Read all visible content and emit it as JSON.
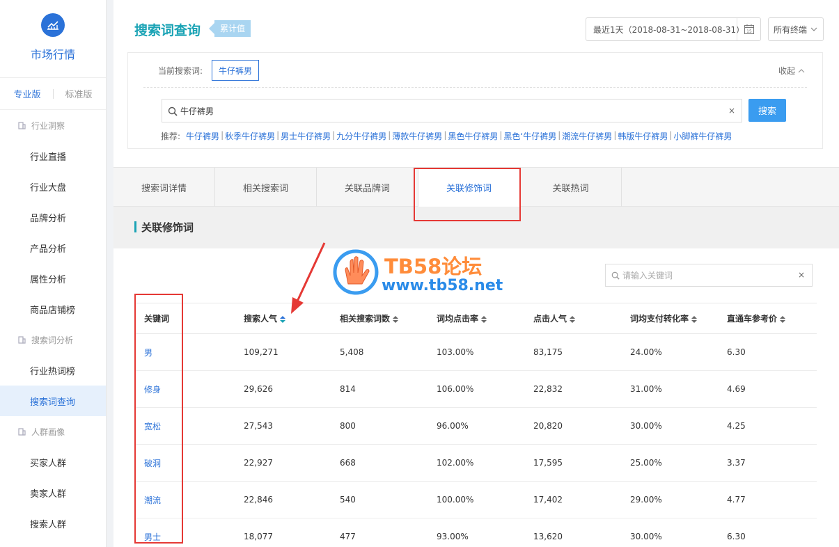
{
  "sidebar": {
    "title": "市场行情",
    "versions": [
      "专业版",
      "标准版"
    ],
    "groups": [
      {
        "label": "行业洞察",
        "items": [
          "行业直播",
          "行业大盘",
          "品牌分析",
          "产品分析",
          "属性分析",
          "商品店铺榜"
        ]
      },
      {
        "label": "搜索词分析",
        "items": [
          "行业热词榜",
          "搜索词查询"
        ]
      },
      {
        "label": "人群画像",
        "items": [
          "买家人群",
          "卖家人群",
          "搜索人群"
        ]
      }
    ],
    "active_item": "搜索词查询"
  },
  "header": {
    "title": "搜索词查询",
    "badge": "累计值",
    "date_range": "最近1天（2018-08-31~2018-08-31）",
    "calendar_day": "15",
    "terminal": "所有终端"
  },
  "search": {
    "current_label": "当前搜索词:",
    "current_term": "牛仔裤男",
    "collapse_label": "收起",
    "input_value": "牛仔裤男",
    "button_label": "搜索",
    "rec_label": "推荐:",
    "recommendations": [
      "牛仔裤男",
      "秋季牛仔裤男",
      "男士牛仔裤男",
      "九分牛仔裤男",
      "薄款牛仔裤男",
      "黑色牛仔裤男",
      "黑色‘牛仔裤男",
      "潮流牛仔裤男",
      "韩版牛仔裤男",
      "小脚裤牛仔裤男"
    ]
  },
  "tabs": [
    "搜索词详情",
    "相关搜索词",
    "关联品牌词",
    "关联修饰词",
    "关联热词"
  ],
  "active_tab": "关联修饰词",
  "section_title": "关联修饰词",
  "filter": {
    "placeholder": "请输入关键词"
  },
  "table": {
    "columns": [
      "关键词",
      "搜索人气",
      "相关搜索词数",
      "词均点击率",
      "点击人气",
      "词均支付转化率",
      "直通车参考价"
    ],
    "rows": [
      [
        "男",
        "109,271",
        "5,408",
        "103.00%",
        "83,175",
        "24.00%",
        "6.30"
      ],
      [
        "修身",
        "29,626",
        "814",
        "106.00%",
        "22,832",
        "31.00%",
        "4.69"
      ],
      [
        "宽松",
        "27,543",
        "800",
        "96.00%",
        "20,820",
        "30.00%",
        "4.25"
      ],
      [
        "破洞",
        "22,927",
        "668",
        "102.00%",
        "17,595",
        "25.00%",
        "3.37"
      ],
      [
        "潮流",
        "22,846",
        "540",
        "100.00%",
        "17,402",
        "29.00%",
        "4.77"
      ],
      [
        "男士",
        "18,077",
        "477",
        "93.00%",
        "13,620",
        "30.00%",
        "6.30"
      ]
    ]
  },
  "watermark": {
    "line1": "TB58论坛",
    "line2": "www.tb58.net"
  },
  "colors": {
    "accent": "#2b72d8",
    "teal": "#1aa3b5",
    "button": "#3a9cf0",
    "highlight": "#e53935"
  }
}
